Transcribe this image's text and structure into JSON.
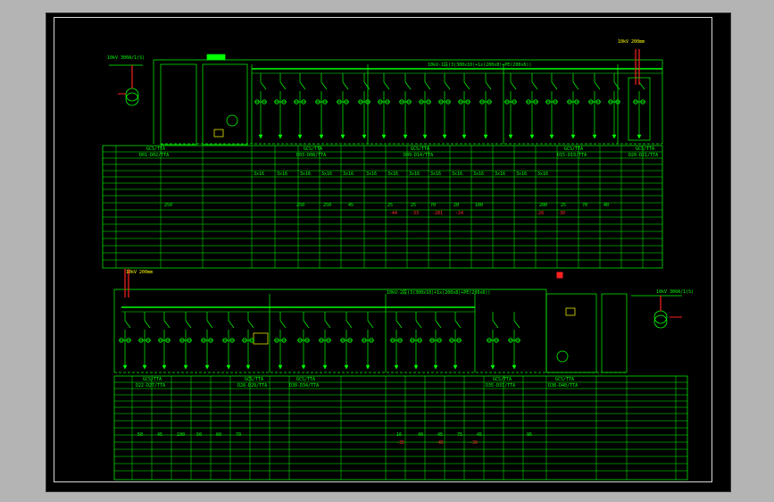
{
  "colors": {
    "background": "#000000",
    "line": "#00ff00",
    "accent": "#ff2020",
    "highlight": "#ffff00",
    "frame": "#d8d8d8",
    "viewport": "#b4b4b4"
  },
  "top": {
    "source_label": "10kV 300A/1(S)",
    "busbar_label": "10kV-1段(3(300x10)+1x(200x8)+PE(200x6))",
    "right_label": "10kV 200mm",
    "feeder_count": 17,
    "section_headers": [
      "GCS/TTA",
      "GCS/TTA",
      "GCS/TTA",
      "GCS/TTA",
      "GCS/TTA"
    ],
    "section_codes": [
      "D01-D02/TTA",
      "D03-D08/TTA",
      "D09-D14/TTA",
      "D15-D19/TTA",
      "D20-D21/TTA"
    ],
    "row_values": [
      "3x16",
      "3x16",
      "3x16",
      "3x16",
      "3x16",
      "3x16",
      "3x16",
      "3x16",
      "3x16",
      "3x16",
      "3x16",
      "3x16",
      "3x16",
      "3x16"
    ],
    "current_values": [
      "250",
      "250",
      "250",
      "45",
      "25",
      "25",
      "70",
      "20",
      "100",
      "200",
      "25",
      "70",
      "40"
    ],
    "red_values": [
      "-44",
      "-33",
      "-281",
      "-24",
      "-28",
      "-30"
    ]
  },
  "bottom": {
    "left_label": "10kV 200mm",
    "busbar_label": "10kV-2段(3(300x10)+1x(200x8)+PE(200x6))",
    "source_label": "10kV 300A/1(S)",
    "feeder_count": 14,
    "section_headers": [
      "GCS/TTA",
      "GCS/TTA",
      "GCS/TTA",
      "GCS/TTA",
      "GCS/TTA"
    ],
    "section_codes": [
      "D22-D27/TTA",
      "D28-D29/TTA",
      "D30-D34/TTA",
      "D35-D37/TTA",
      "D38-D40/TTA"
    ],
    "row_values": [
      "50",
      "45",
      "100",
      "50",
      "60",
      "70",
      "16",
      "40",
      "45",
      "75",
      "45",
      "95"
    ],
    "red_values": [
      "-35",
      "-45",
      "-30"
    ]
  }
}
